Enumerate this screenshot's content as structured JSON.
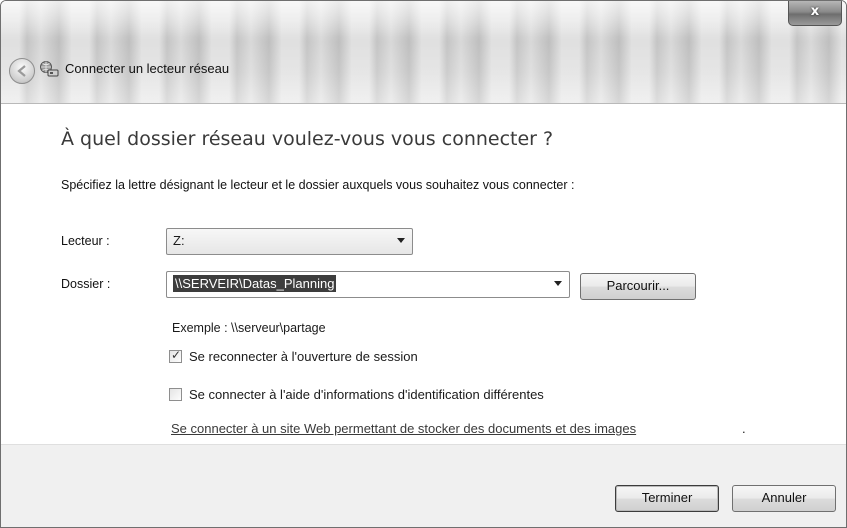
{
  "window": {
    "title": "Connecter un lecteur réseau",
    "close_label": "x"
  },
  "main": {
    "heading": "À quel dossier réseau voulez-vous vous connecter ?",
    "instruction": "Spécifiez la lettre désignant le lecteur et le dossier auxquels vous souhaitez vous connecter :",
    "drive_label": "Lecteur :",
    "drive_value": "Z:",
    "folder_label": "Dossier :",
    "folder_value": "\\\\SERVEIR\\Datas_Planning",
    "browse_label": "Parcourir...",
    "example": "Exemple : \\\\serveur\\partage",
    "reconnect_label": "Se reconnecter à l'ouverture de session",
    "reconnect_checked": true,
    "other_creds_label": "Se connecter à l'aide d'informations d'identification différentes",
    "other_creds_checked": false,
    "website_link": "Se connecter à un site Web permettant de stocker des documents et des images",
    "website_link_suffix": "."
  },
  "footer": {
    "finish_label": "Terminer",
    "cancel_label": "Annuler"
  },
  "icons": {
    "back": "back-arrow-icon",
    "network_drive": "network-drive-icon",
    "dropdown": "chevron-down-icon",
    "check": "checkmark-icon"
  }
}
